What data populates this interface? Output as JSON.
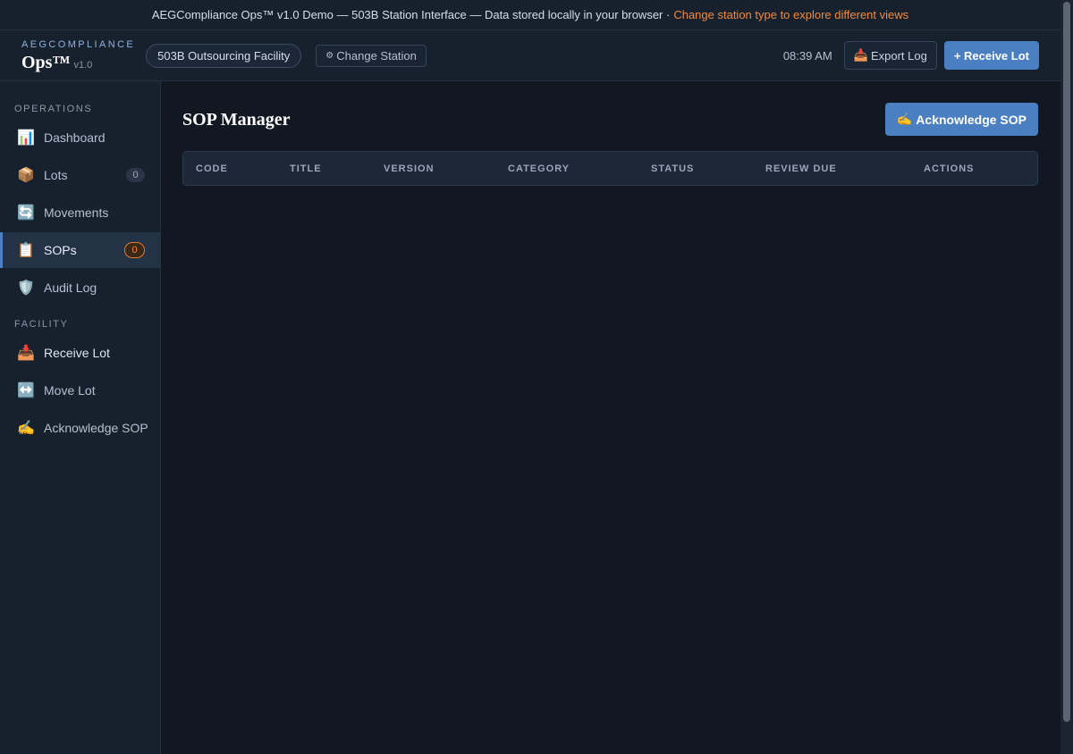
{
  "banner": {
    "text": "AEGCompliance Ops™ v1.0 Demo — 503B Station Interface — Data stored locally in your browser ·",
    "link": "Change station type to explore different views"
  },
  "header": {
    "brand_top": "AEGCOMPLIANCE",
    "brand_name": "Ops™",
    "brand_version": "v1.0",
    "station": "503B Outsourcing Facility",
    "change_station": "Change Station",
    "time": "08:39 AM",
    "export_log": "Export Log",
    "receive_lot": "+ Receive Lot"
  },
  "sidebar": {
    "section_operations": "OPERATIONS",
    "section_facility": "FACILITY",
    "operations": [
      {
        "label": "Dashboard",
        "icon": "chart-icon"
      },
      {
        "label": "Lots",
        "icon": "package-icon",
        "count": "0"
      },
      {
        "label": "Movements",
        "icon": "refresh-icon"
      },
      {
        "label": "SOPs",
        "icon": "clipboard-icon",
        "count": "0"
      },
      {
        "label": "Audit Log",
        "icon": "shield-icon"
      }
    ],
    "facility": [
      {
        "label": "Receive Lot",
        "icon": "inbox-tray-icon"
      },
      {
        "label": "Move Lot",
        "icon": "left-right-arrow-icon"
      },
      {
        "label": "Acknowledge SOP",
        "icon": "writing-hand-icon"
      }
    ]
  },
  "main": {
    "title": "SOP Manager",
    "acknowledge_button": "Acknowledge SOP",
    "columns": [
      "CODE",
      "TITLE",
      "VERSION",
      "CATEGORY",
      "STATUS",
      "REVIEW DUE",
      "ACTIONS"
    ]
  },
  "colors": {
    "accent": "#4a7fc1",
    "warning": "#f08a3c",
    "background": "#111821",
    "panel": "#17212e"
  }
}
